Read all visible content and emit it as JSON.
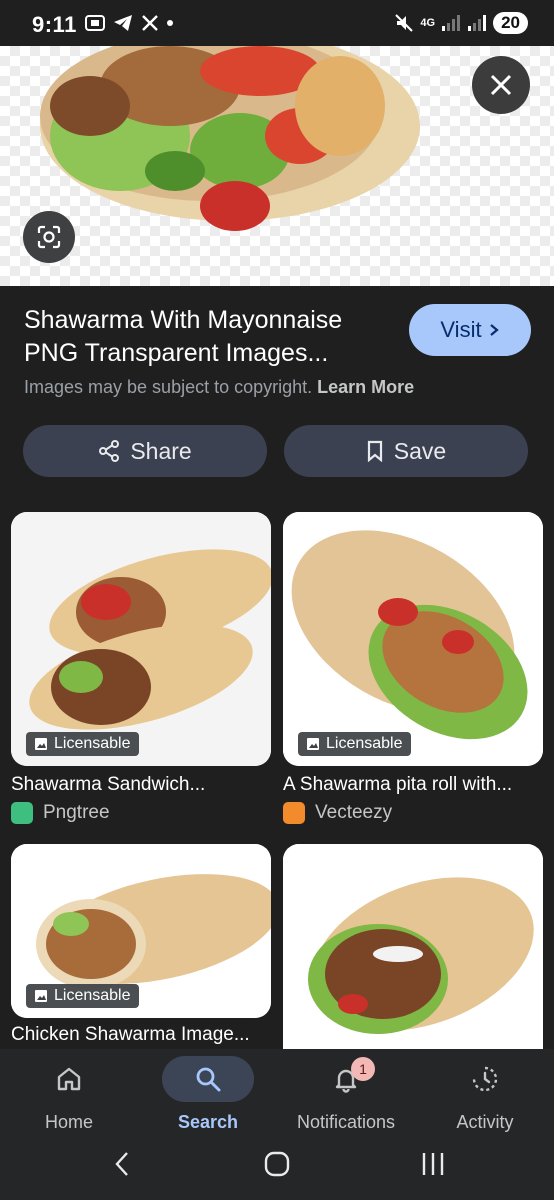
{
  "status": {
    "time": "9:11",
    "network": "4G",
    "battery": "20"
  },
  "result": {
    "title": "Shawarma With Mayonnaise PNG Transparent Images...",
    "visit_label": "Visit",
    "copyright_text": "Images may be subject to copyright.",
    "learn_more": "Learn More"
  },
  "actions": {
    "share_label": "Share",
    "save_label": "Save"
  },
  "related": [
    {
      "title": "Shawarma Sandwich...",
      "source": "Pngtree",
      "badge": "Licensable",
      "source_color": "#3fbf7f"
    },
    {
      "title": "A Shawarma pita roll with...",
      "source": "Vecteezy",
      "badge": "Licensable",
      "source_color": "#f28b2c"
    },
    {
      "title": "Chicken Shawarma Image...",
      "source": "",
      "badge": "Licensable",
      "source_color": ""
    },
    {
      "title": "",
      "source": "",
      "badge": "",
      "source_color": ""
    }
  ],
  "nav": {
    "items": [
      {
        "label": "Home",
        "icon": "home-icon"
      },
      {
        "label": "Search",
        "icon": "search-icon"
      },
      {
        "label": "Notifications",
        "icon": "bell-icon"
      },
      {
        "label": "Activity",
        "icon": "activity-icon"
      }
    ],
    "notification_count": "1"
  },
  "colors": {
    "accent": "#a8c7fa",
    "background": "#1f1f1f",
    "button_bg": "#3b4150"
  }
}
